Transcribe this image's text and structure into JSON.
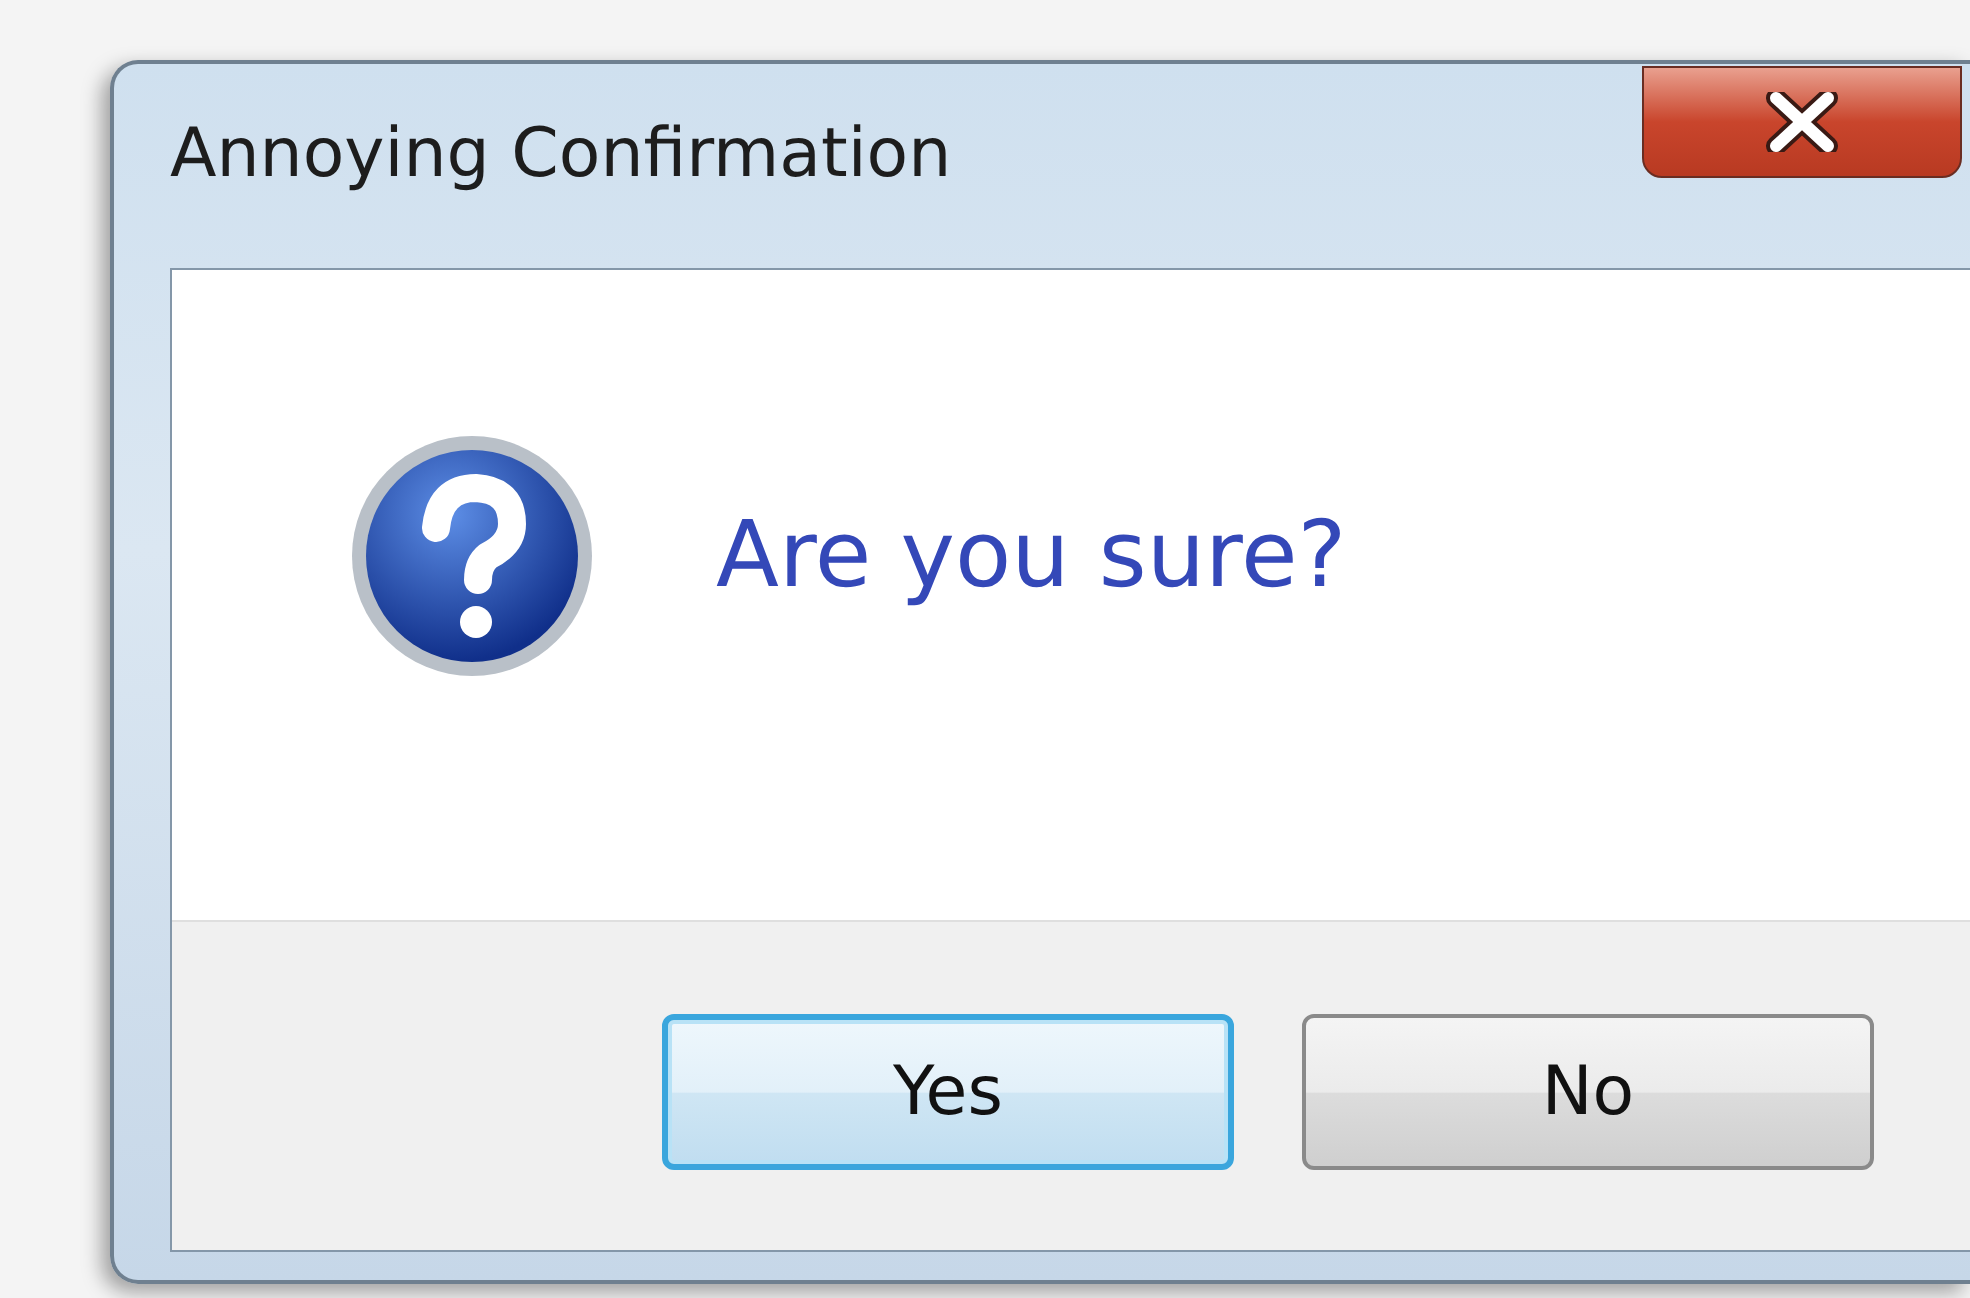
{
  "window": {
    "title": "Annoying Confirmation"
  },
  "message": "Are you sure?",
  "buttons": [
    {
      "label": "Yes",
      "focused": true
    },
    {
      "label": "No",
      "focused": false
    }
  ]
}
